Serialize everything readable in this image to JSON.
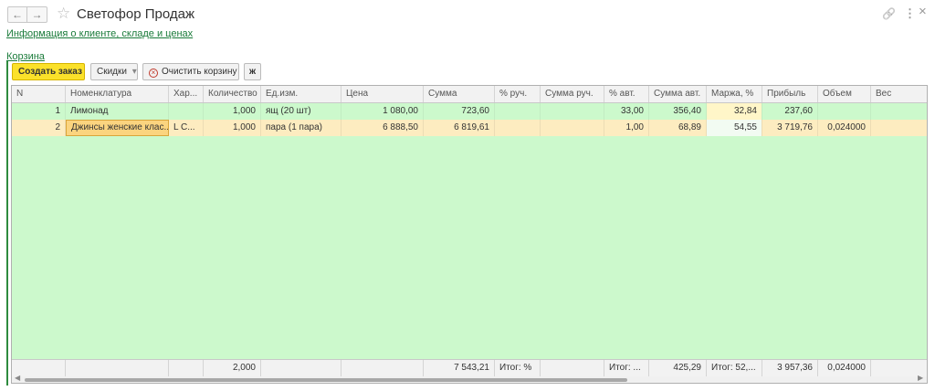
{
  "window": {
    "title": "Светофор Продаж",
    "back_glyph": "←",
    "forward_glyph": "→",
    "favorite_glyph": "☆",
    "link_glyph": "🔗",
    "more_glyph": "⋮",
    "close_glyph": "×"
  },
  "links": {
    "client_info": "Информация о клиенте, складе и ценах",
    "cart": "Корзина"
  },
  "toolbar": {
    "create_order": "Создать заказ",
    "discounts": "Скидки",
    "discounts_arrow": "▾",
    "clear_cart": "Очистить корзину",
    "clear_glyph": "×",
    "settings_glyph": "ж"
  },
  "table": {
    "columns": [
      "N",
      "Номенклатура",
      "Хар...",
      "Количество",
      "Ед.изм.",
      "Цена",
      "Сумма",
      "% руч.",
      "Сумма руч.",
      "% авт.",
      "Сумма авт.",
      "Маржа, %",
      "Прибыль",
      "Объем",
      "Вес"
    ],
    "rows": [
      [
        "1",
        "Лимонад",
        "",
        "1,000",
        "ящ (20 шт)",
        "1 080,00",
        "723,60",
        "",
        "",
        "33,00",
        "356,40",
        "32,84",
        "237,60",
        "",
        ""
      ],
      [
        "2",
        "Джинсы женские клас...",
        "L C...",
        "1,000",
        "пара (1 пара)",
        "6 888,50",
        "6 819,61",
        "",
        "",
        "1,00",
        "68,89",
        "54,55",
        "3 719,76",
        "0,024000",
        ""
      ]
    ],
    "footer": [
      "",
      "",
      "",
      "2,000",
      "",
      "",
      "7 543,21",
      "Итог: %",
      "",
      "Итог: ...",
      "425,29",
      "Итог: 52,...",
      "3 957,36",
      "0,024000",
      ""
    ]
  },
  "colors": {
    "accent_green": "#1a7b3a",
    "grid_bg": "#ccf9cc",
    "selected_row_bg": "#fdecc0",
    "primary_button": "#fbe12a"
  }
}
